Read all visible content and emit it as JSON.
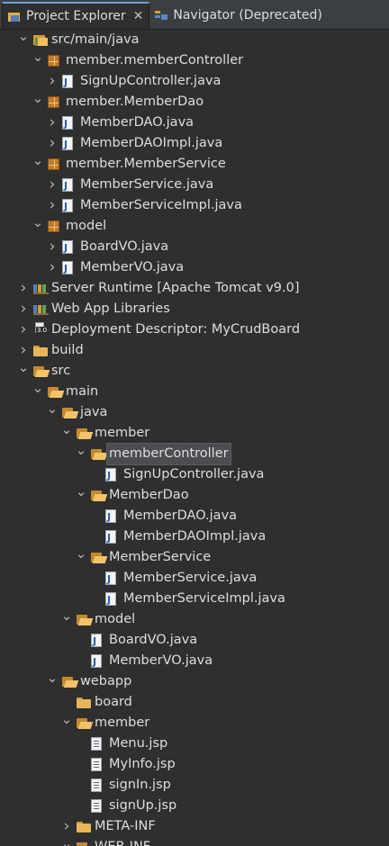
{
  "tabs": [
    {
      "label": "Project Explorer",
      "active": true,
      "icon": "project-explorer-icon"
    },
    {
      "label": "Navigator (Deprecated)",
      "active": false,
      "icon": "navigator-icon"
    }
  ],
  "tree": [
    {
      "label": "src/main/java",
      "indent": 1,
      "twisty": "expanded",
      "icon": "source-folder-icon"
    },
    {
      "label": "member.memberController",
      "indent": 2,
      "twisty": "expanded",
      "icon": "package-icon"
    },
    {
      "label": "SignUpController.java",
      "indent": 3,
      "twisty": "collapsed",
      "icon": "java-file-icon"
    },
    {
      "label": "member.MemberDao",
      "indent": 2,
      "twisty": "expanded",
      "icon": "package-icon"
    },
    {
      "label": "MemberDAO.java",
      "indent": 3,
      "twisty": "collapsed",
      "icon": "java-file-icon"
    },
    {
      "label": "MemberDAOImpl.java",
      "indent": 3,
      "twisty": "collapsed",
      "icon": "java-file-icon"
    },
    {
      "label": "member.MemberService",
      "indent": 2,
      "twisty": "expanded",
      "icon": "package-icon"
    },
    {
      "label": "MemberService.java",
      "indent": 3,
      "twisty": "collapsed",
      "icon": "java-file-icon"
    },
    {
      "label": "MemberServiceImpl.java",
      "indent": 3,
      "twisty": "collapsed",
      "icon": "java-file-icon"
    },
    {
      "label": "model",
      "indent": 2,
      "twisty": "expanded",
      "icon": "package-icon"
    },
    {
      "label": "BoardVO.java",
      "indent": 3,
      "twisty": "collapsed",
      "icon": "java-file-icon"
    },
    {
      "label": "MemberVO.java",
      "indent": 3,
      "twisty": "collapsed",
      "icon": "java-file-icon"
    },
    {
      "label": "Server Runtime [Apache Tomcat v9.0]",
      "indent": 1,
      "twisty": "collapsed",
      "icon": "library-icon"
    },
    {
      "label": "Web App Libraries",
      "indent": 1,
      "twisty": "collapsed",
      "icon": "library-icon"
    },
    {
      "label": "Deployment Descriptor: MyCrudBoard",
      "indent": 1,
      "twisty": "collapsed",
      "icon": "deployment-descriptor-icon"
    },
    {
      "label": "build",
      "indent": 1,
      "twisty": "collapsed",
      "icon": "folder-icon"
    },
    {
      "label": "src",
      "indent": 1,
      "twisty": "expanded",
      "icon": "folder-open-icon"
    },
    {
      "label": "main",
      "indent": 2,
      "twisty": "expanded",
      "icon": "folder-open-icon"
    },
    {
      "label": "java",
      "indent": 3,
      "twisty": "expanded",
      "icon": "folder-open-icon"
    },
    {
      "label": "member",
      "indent": 4,
      "twisty": "expanded",
      "icon": "folder-open-icon"
    },
    {
      "label": "memberController",
      "indent": 5,
      "twisty": "expanded",
      "icon": "folder-open-icon",
      "selected": true
    },
    {
      "label": "SignUpController.java",
      "indent": 6,
      "twisty": "none",
      "icon": "java-file-icon"
    },
    {
      "label": "MemberDao",
      "indent": 5,
      "twisty": "expanded",
      "icon": "folder-open-icon"
    },
    {
      "label": "MemberDAO.java",
      "indent": 6,
      "twisty": "none",
      "icon": "java-file-icon"
    },
    {
      "label": "MemberDAOImpl.java",
      "indent": 6,
      "twisty": "none",
      "icon": "java-file-icon"
    },
    {
      "label": "MemberService",
      "indent": 5,
      "twisty": "expanded",
      "icon": "folder-open-icon"
    },
    {
      "label": "MemberService.java",
      "indent": 6,
      "twisty": "none",
      "icon": "java-file-icon"
    },
    {
      "label": "MemberServiceImpl.java",
      "indent": 6,
      "twisty": "none",
      "icon": "java-file-icon"
    },
    {
      "label": "model",
      "indent": 4,
      "twisty": "expanded",
      "icon": "folder-open-icon"
    },
    {
      "label": "BoardVO.java",
      "indent": 5,
      "twisty": "none",
      "icon": "java-file-icon"
    },
    {
      "label": "MemberVO.java",
      "indent": 5,
      "twisty": "none",
      "icon": "java-file-icon"
    },
    {
      "label": "webapp",
      "indent": 3,
      "twisty": "expanded",
      "icon": "folder-open-icon"
    },
    {
      "label": "board",
      "indent": 4,
      "twisty": "none",
      "icon": "folder-icon"
    },
    {
      "label": "member",
      "indent": 4,
      "twisty": "expanded",
      "icon": "folder-open-icon"
    },
    {
      "label": "Menu.jsp",
      "indent": 5,
      "twisty": "none",
      "icon": "jsp-file-icon"
    },
    {
      "label": "MyInfo.jsp",
      "indent": 5,
      "twisty": "none",
      "icon": "jsp-file-icon"
    },
    {
      "label": "signIn.jsp",
      "indent": 5,
      "twisty": "none",
      "icon": "jsp-file-icon"
    },
    {
      "label": "signUp.jsp",
      "indent": 5,
      "twisty": "none",
      "icon": "jsp-file-icon"
    },
    {
      "label": "META-INF",
      "indent": 4,
      "twisty": "collapsed",
      "icon": "folder-icon"
    },
    {
      "label": "WEB-INF",
      "indent": 4,
      "twisty": "expanded",
      "icon": "folder-open-icon"
    }
  ],
  "colors": {
    "background": "#2f2f2f",
    "tab_bar": "#3c3f41",
    "selection": "#4b4d50",
    "text": "#dedede"
  }
}
